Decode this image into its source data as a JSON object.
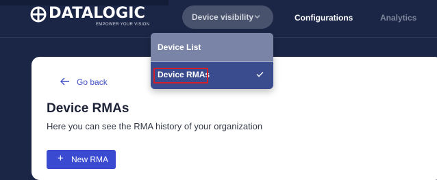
{
  "brand": {
    "name": "DATALOGIC",
    "tagline": "EMPOWER YOUR VISION"
  },
  "nav": {
    "device_visibility": "Device visibility",
    "configurations": "Configurations",
    "analytics": "Analytics"
  },
  "dropdown": {
    "items": [
      {
        "label": "Device List",
        "selected": false
      },
      {
        "label": "Device RMAs",
        "selected": true
      }
    ]
  },
  "page": {
    "back_label": "Go back",
    "title": "Device RMAs",
    "subtitle": "Here you can see the RMA history of your organization",
    "new_button": "New RMA"
  },
  "colors": {
    "topbar": "#1b2646",
    "accent": "#3a4bd2",
    "dropdown_selected": "#3a4b8e",
    "highlight": "#d11f2a"
  },
  "icons": {
    "nav_chevron": "chevron-down-icon",
    "back": "arrow-left-icon",
    "selected": "check-icon",
    "new": "plus-icon"
  }
}
